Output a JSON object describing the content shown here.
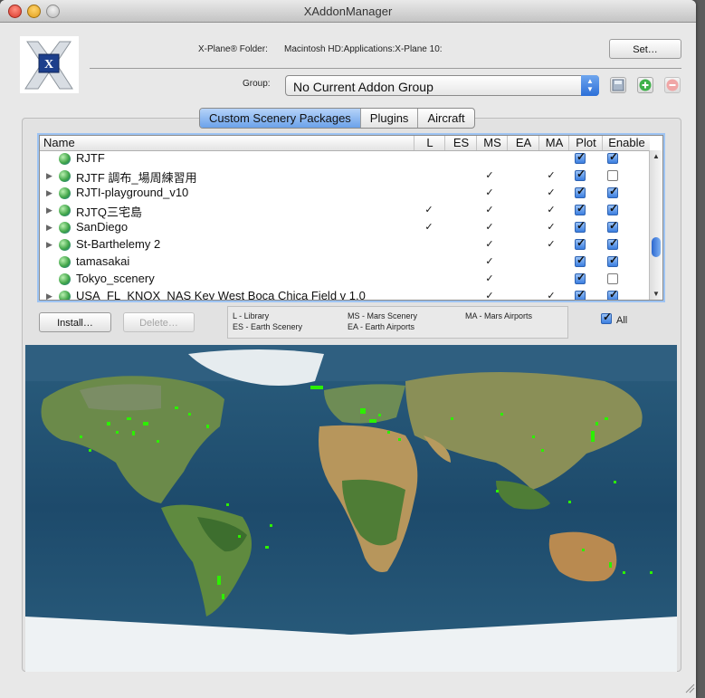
{
  "window": {
    "title": "XAddonManager"
  },
  "header": {
    "folder_label": "X-Plane® Folder:",
    "folder_path": "Macintosh HD:Applications:X-Plane 10:",
    "set_button": "Set…",
    "group_label": "Group:",
    "group_value": "No Current Addon Group",
    "app_icon_letter": "X"
  },
  "tabs": [
    {
      "label": "Custom Scenery Packages",
      "active": true
    },
    {
      "label": "Plugins",
      "active": false
    },
    {
      "label": "Aircraft",
      "active": false
    }
  ],
  "table": {
    "columns": [
      "Name",
      "L",
      "ES",
      "MS",
      "EA",
      "MA",
      "Plot",
      "Enable"
    ],
    "rows": [
      {
        "name": "RJTF",
        "disclosure": false,
        "L": "",
        "ES": "",
        "EA": "",
        "plot": true,
        "enable": true
      },
      {
        "name": "RJTF 調布_場周練習用",
        "disclosure": true,
        "L": "",
        "ES": "✓",
        "EA": "✓",
        "plot": true,
        "enable": false
      },
      {
        "name": "RJTI-playground_v10",
        "disclosure": true,
        "L": "",
        "ES": "✓",
        "EA": "✓",
        "plot": true,
        "enable": true
      },
      {
        "name": "RJTQ三宅島",
        "disclosure": true,
        "L": "✓",
        "ES": "✓",
        "EA": "✓",
        "plot": true,
        "enable": true
      },
      {
        "name": "SanDiego",
        "disclosure": true,
        "L": "✓",
        "ES": "✓",
        "EA": "✓",
        "plot": true,
        "enable": true
      },
      {
        "name": "St-Barthelemy 2",
        "disclosure": true,
        "L": "",
        "ES": "✓",
        "EA": "✓",
        "plot": true,
        "enable": true
      },
      {
        "name": "tamasakai",
        "disclosure": false,
        "L": "",
        "ES": "✓",
        "EA": "",
        "plot": true,
        "enable": true
      },
      {
        "name": "Tokyo_scenery",
        "disclosure": false,
        "L": "",
        "ES": "✓",
        "EA": "",
        "plot": true,
        "enable": false
      },
      {
        "name": "USA_FL_KNQX_NAS Key West Boca Chica Field v 1.0",
        "disclosure": true,
        "L": "",
        "ES": "✓",
        "EA": "✓",
        "plot": true,
        "enable": true
      }
    ]
  },
  "actions": {
    "install": "Install…",
    "delete": "Delete…",
    "all_label": "All",
    "all_checked": true
  },
  "legend": {
    "library": "L - Library",
    "earth_scenery": "ES - Earth Scenery",
    "mars_scenery": "MS - Mars Scenery",
    "earth_airports": "EA - Earth Airports",
    "mars_airports": "MA - Mars Airports"
  },
  "colors": {
    "accent": "#3b7ee0",
    "scenery_marker": "#2cf000",
    "ocean": "#1d4a6b"
  }
}
